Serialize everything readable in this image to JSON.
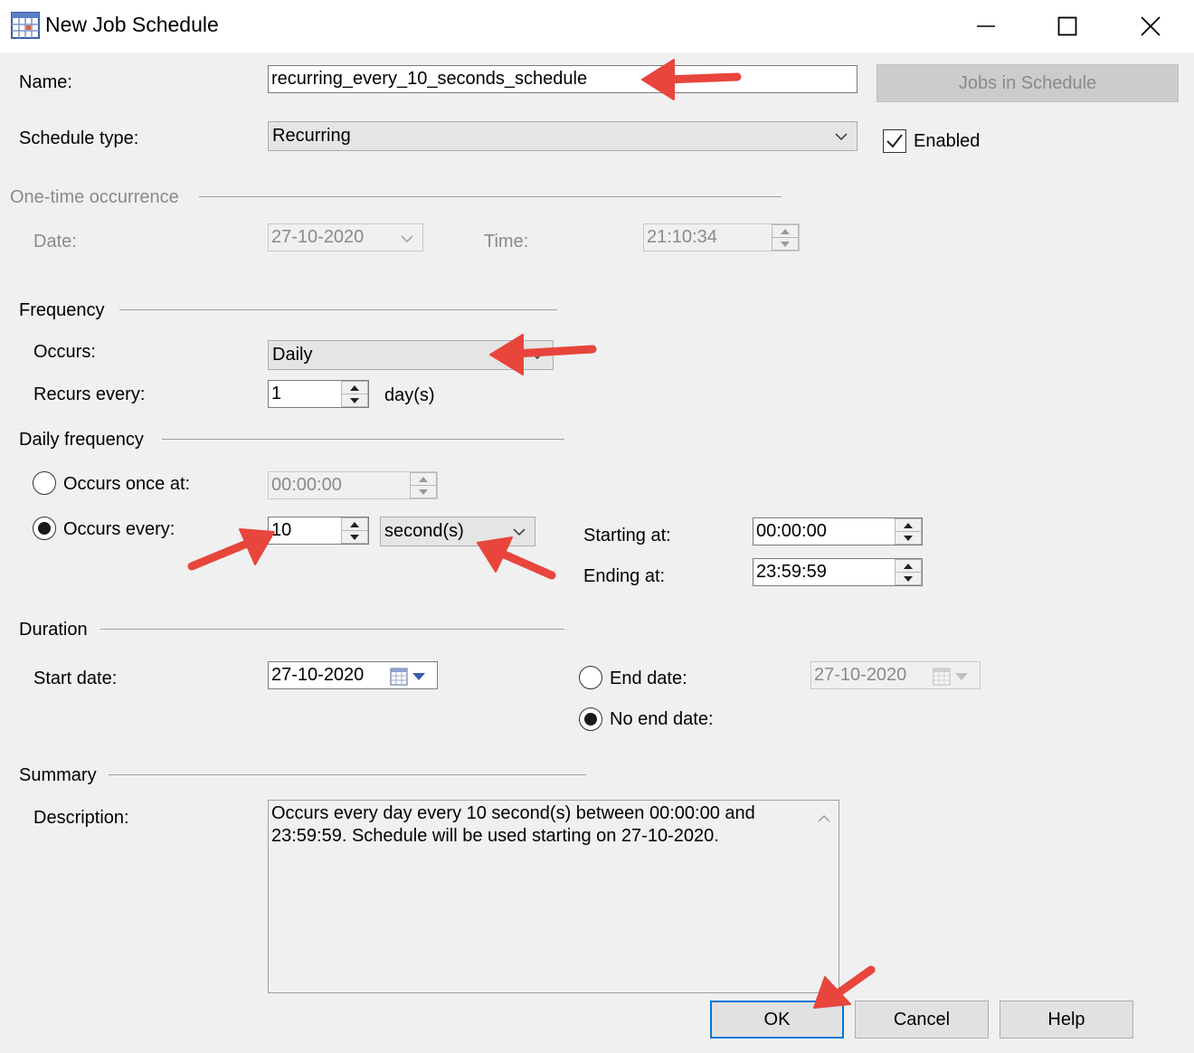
{
  "window": {
    "title": "New Job Schedule"
  },
  "name": {
    "label": "Name:",
    "value": "recurring_every_10_seconds_schedule"
  },
  "jobs_in_schedule_button": "Jobs in Schedule",
  "schedule_type": {
    "label": "Schedule type:",
    "value": "Recurring"
  },
  "enabled": {
    "label": "Enabled",
    "checked": true
  },
  "one_time": {
    "header": "One-time occurrence",
    "date_label": "Date:",
    "date_value": "27-10-2020",
    "time_label": "Time:",
    "time_value": "21:10:34"
  },
  "frequency": {
    "header": "Frequency",
    "occurs_label": "Occurs:",
    "occurs_value": "Daily",
    "recurs_label": "Recurs every:",
    "recurs_value": "1",
    "recurs_unit": "day(s)"
  },
  "daily_frequency": {
    "header": "Daily frequency",
    "once_label": "Occurs once at:",
    "once_value": "00:00:00",
    "every_label": "Occurs every:",
    "every_value": "10",
    "every_unit": "second(s)",
    "starting_label": "Starting at:",
    "starting_value": "00:00:00",
    "ending_label": "Ending at:",
    "ending_value": "23:59:59",
    "selected": "every"
  },
  "duration": {
    "header": "Duration",
    "start_label": "Start date:",
    "start_value": "27-10-2020",
    "end_label": "End date:",
    "end_value": "27-10-2020",
    "no_end_label": "No end date:",
    "selected": "no_end"
  },
  "summary": {
    "header": "Summary",
    "description_label": "Description:",
    "description_text": "Occurs every day every 10 second(s) between 00:00:00 and 23:59:59. Schedule will be used starting on 27-10-2020."
  },
  "buttons": {
    "ok": "OK",
    "cancel": "Cancel",
    "help": "Help"
  },
  "colors": {
    "dialog_bg": "#f0f0f0",
    "title_bg": "#ffffff",
    "focus_border": "#0078d7",
    "annotation_arrow": "#e8453c"
  }
}
